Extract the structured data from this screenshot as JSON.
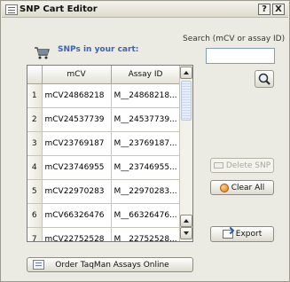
{
  "window": {
    "title": "SNP Cart Editor",
    "help_label": "?",
    "close_label": "X"
  },
  "cart": {
    "label": "SNPs in your cart:"
  },
  "search": {
    "label": "Search (mCV or assay ID)",
    "value": "",
    "placeholder": ""
  },
  "table": {
    "headers": [
      "mCV",
      "Assay ID"
    ],
    "rows": [
      {
        "num": "1",
        "mcv": "mCV24868218",
        "assay": "M__24868218..."
      },
      {
        "num": "2",
        "mcv": "mCV24537739",
        "assay": "M__24537739..."
      },
      {
        "num": "3",
        "mcv": "mCV23769187",
        "assay": "M__23769187..."
      },
      {
        "num": "4",
        "mcv": "mCV23746955",
        "assay": "M__23746955..."
      },
      {
        "num": "5",
        "mcv": "mCV22970283",
        "assay": "M__22970283..."
      },
      {
        "num": "6",
        "mcv": "mCV66326476",
        "assay": "M__66326476..."
      },
      {
        "num": "7",
        "mcv": "mCV22752528",
        "assay": "M__22752528..."
      }
    ]
  },
  "buttons": {
    "delete_snp": "Delete SNP",
    "clear_all": "Clear All",
    "export": "Export",
    "order": "Order TaqMan Assays Online"
  },
  "icons": {
    "app": "list-icon",
    "cart": "shopping-cart-icon",
    "search": "magnifier-icon",
    "delete": "delete-icon",
    "clear": "clear-icon",
    "export": "export-icon",
    "order": "order-icon"
  },
  "colors": {
    "cart_label": "#3a63b8",
    "window_bg": "#ecebe3"
  }
}
